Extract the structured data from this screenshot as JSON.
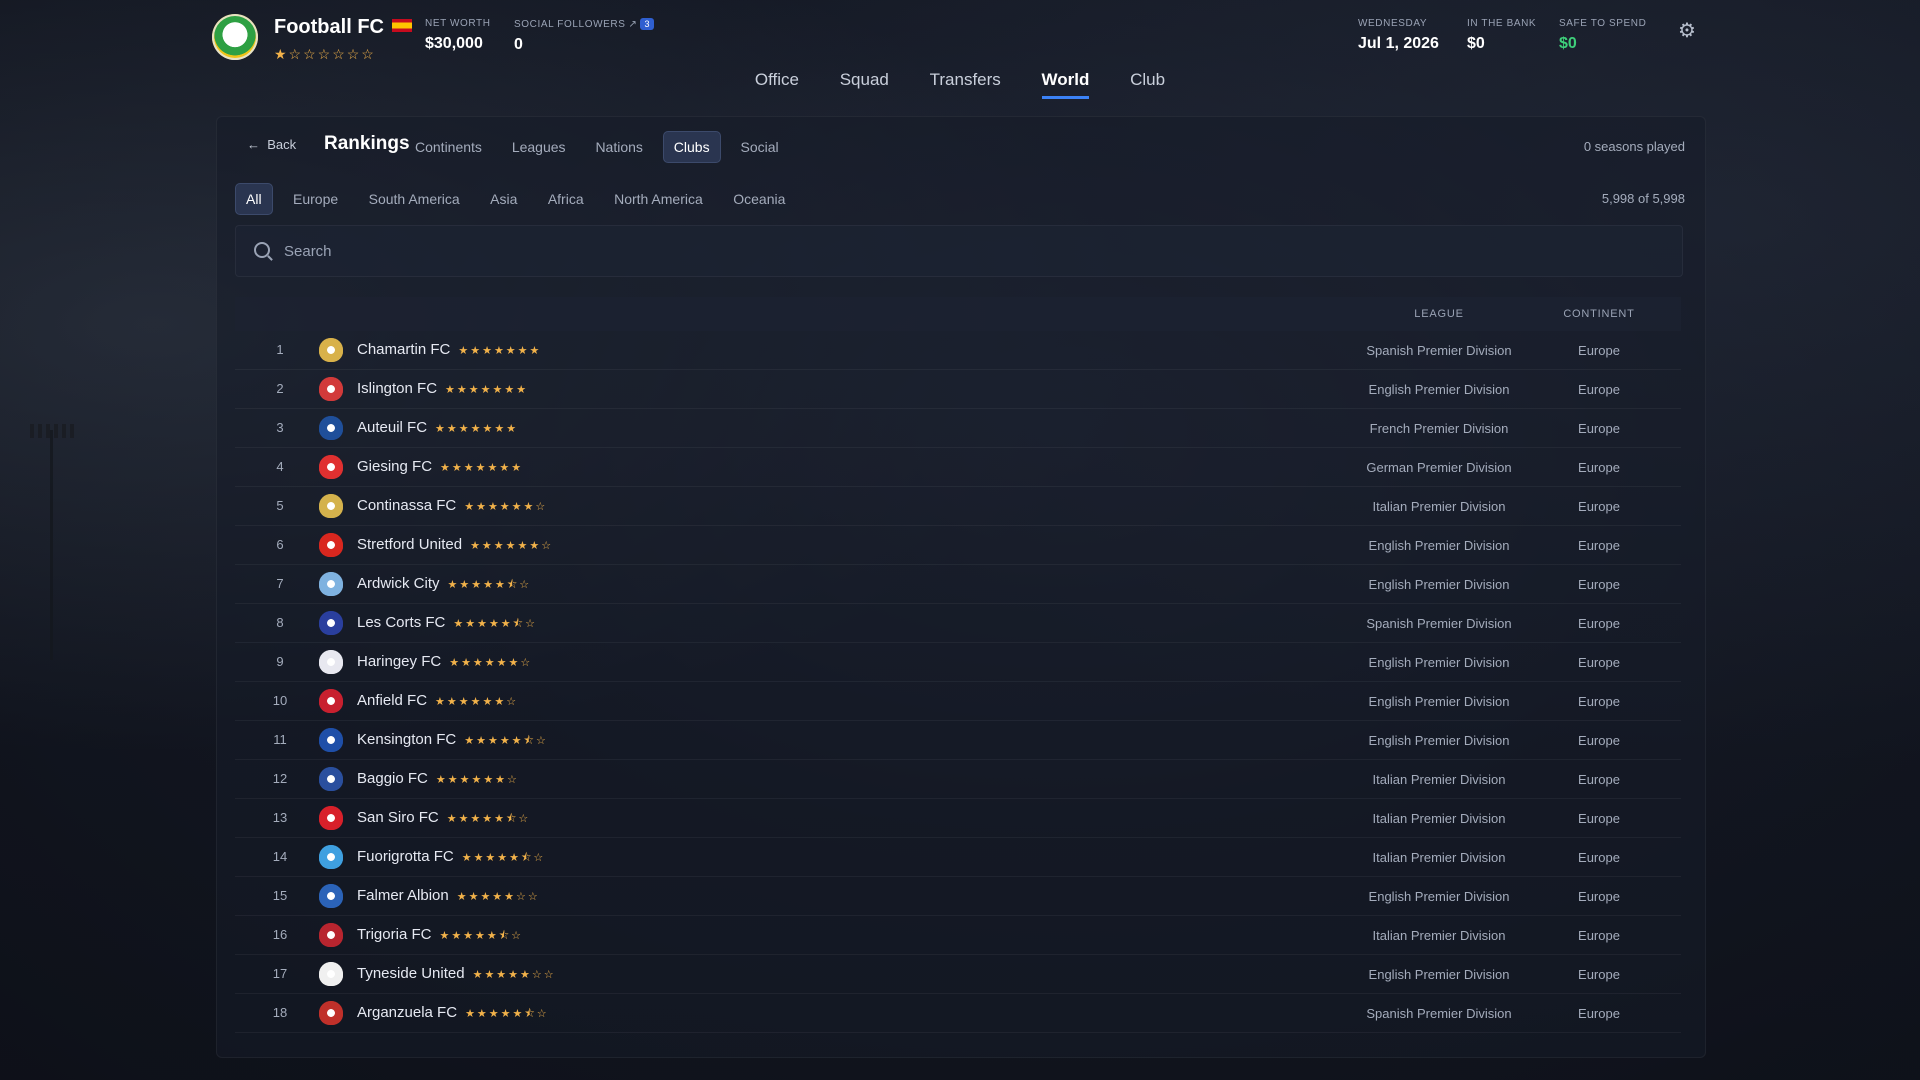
{
  "header": {
    "club_name": "Football FC",
    "club_rating": "★☆☆☆☆☆☆",
    "net_worth_label": "NET WORTH",
    "net_worth": "$30,000",
    "followers_label": "SOCIAL FOLLOWERS",
    "followers_badge": "3",
    "followers": "0",
    "day_label": "WEDNESDAY",
    "date": "Jul 1, 2026",
    "bank_label": "IN THE BANK",
    "bank": "$0",
    "safe_label": "SAFE TO SPEND",
    "safe": "$0"
  },
  "nav": [
    "Office",
    "Squad",
    "Transfers",
    "World",
    "Club"
  ],
  "rankings": {
    "back": "Back",
    "title": "Rankings",
    "tabs": [
      "Continents",
      "Leagues",
      "Nations",
      "Clubs",
      "Social"
    ],
    "seasons": "0 seasons played",
    "filters": [
      "All",
      "Europe",
      "South America",
      "Asia",
      "Africa",
      "North America",
      "Oceania"
    ],
    "count": "5,998 of 5,998",
    "search_placeholder": "Search",
    "col_league": "LEAGUE",
    "col_continent": "CONTINENT"
  },
  "rows": [
    {
      "rank": "1",
      "name": "Chamartin FC",
      "stars": "★★★★★★★",
      "league": "Spanish Premier Division",
      "continent": "Europe",
      "crest": "#d8b14a"
    },
    {
      "rank": "2",
      "name": "Islington FC",
      "stars": "★★★★★★★",
      "league": "English Premier Division",
      "continent": "Europe",
      "crest": "#d23a3a"
    },
    {
      "rank": "3",
      "name": "Auteuil FC",
      "stars": "★★★★★★★",
      "league": "French Premier Division",
      "continent": "Europe",
      "crest": "#1f4f9a"
    },
    {
      "rank": "4",
      "name": "Giesing FC",
      "stars": "★★★★★★★",
      "league": "German Premier Division",
      "continent": "Europe",
      "crest": "#e03030"
    },
    {
      "rank": "5",
      "name": "Continassa FC",
      "stars": "★★★★★★☆",
      "league": "Italian Premier Division",
      "continent": "Europe",
      "crest": "#d4b24c"
    },
    {
      "rank": "6",
      "name": "Stretford United",
      "stars": "★★★★★★☆",
      "league": "English Premier Division",
      "continent": "Europe",
      "crest": "#d9271f"
    },
    {
      "rank": "7",
      "name": "Ardwick City",
      "stars": "★★★★★⯪☆",
      "league": "English Premier Division",
      "continent": "Europe",
      "crest": "#7fb2e0"
    },
    {
      "rank": "8",
      "name": "Les Corts FC",
      "stars": "★★★★★⯪☆",
      "league": "Spanish Premier Division",
      "continent": "Europe",
      "crest": "#2a3f9e"
    },
    {
      "rank": "9",
      "name": "Haringey FC",
      "stars": "★★★★★★☆",
      "league": "English Premier Division",
      "continent": "Europe",
      "crest": "#e8e8f0"
    },
    {
      "rank": "10",
      "name": "Anfield FC",
      "stars": "★★★★★★☆",
      "league": "English Premier Division",
      "continent": "Europe",
      "crest": "#c8202f"
    },
    {
      "rank": "11",
      "name": "Kensington FC",
      "stars": "★★★★★⯪☆",
      "league": "English Premier Division",
      "continent": "Europe",
      "crest": "#1f4fa8"
    },
    {
      "rank": "12",
      "name": "Baggio FC",
      "stars": "★★★★★★☆",
      "league": "Italian Premier Division",
      "continent": "Europe",
      "crest": "#2a4f9e"
    },
    {
      "rank": "13",
      "name": "San Siro FC",
      "stars": "★★★★★⯪☆",
      "league": "Italian Premier Division",
      "continent": "Europe",
      "crest": "#d8202a"
    },
    {
      "rank": "14",
      "name": "Fuorigrotta FC",
      "stars": "★★★★★⯪☆",
      "league": "Italian Premier Division",
      "continent": "Europe",
      "crest": "#3fa0e0"
    },
    {
      "rank": "15",
      "name": "Falmer Albion",
      "stars": "★★★★★☆☆",
      "league": "English Premier Division",
      "continent": "Europe",
      "crest": "#2b63b8"
    },
    {
      "rank": "16",
      "name": "Trigoria FC",
      "stars": "★★★★★⯪☆",
      "league": "Italian Premier Division",
      "continent": "Europe",
      "crest": "#b8252f"
    },
    {
      "rank": "17",
      "name": "Tyneside United",
      "stars": "★★★★★☆☆",
      "league": "English Premier Division",
      "continent": "Europe",
      "crest": "#f0f0f0"
    },
    {
      "rank": "18",
      "name": "Arganzuela FC",
      "stars": "★★★★★⯪☆",
      "league": "Spanish Premier Division",
      "continent": "Europe",
      "crest": "#c0302a"
    }
  ]
}
